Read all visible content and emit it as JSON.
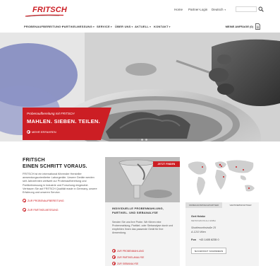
{
  "brand": {
    "name": "FRITSCH",
    "accent": "#cc1e24"
  },
  "top_links": {
    "home": "Home",
    "partner_login": "Partner-Login",
    "language": "Deutsch",
    "search_icon": "search-icon"
  },
  "nav": {
    "items": [
      "PROBENAUFBEREITUNG",
      "PARTIKELMESSUNG",
      "SERVICE",
      "ÜBER UNS",
      "AKTUELL",
      "KONTAKT"
    ],
    "cta": "MEINE ANFRAGE (0)",
    "cta_icon": "document-icon"
  },
  "hero": {
    "kicker": "Probenaufbereitung mit FRITSCH",
    "title": "MAHLEN. SIEBEN. TEILEN.",
    "link": "MEHR ERFAHREN",
    "slide_count": 3,
    "active_slide": 1
  },
  "intro": {
    "title_line1": "FRITSCH",
    "title_line2": "EINEN SCHRITT VORAUS.",
    "body": "FRITSCH ist ein international führender Hersteller anwendungsorientierter Laborgeräte. Unsere Geräte werden seit Jahrzehnten weltweit zur Proben­aufbereitung und Partikelmessung in Industrie und Forschung eingesetzt. Vertrauen Sie auf FRITSCH Qualität made in Germany, unsere Erfahrung und unseren Service.",
    "link1": "ZUR PROBENAUFBEREITUNG",
    "link2": "ZUR PARTIKELMESSUNG"
  },
  "card": {
    "badge": "JETZT FINDEN",
    "title": "INDIVIDUELLE PROBENMAHLUNG, PARTIKEL- UND SIEBANALYSE",
    "body": "Senden Sie uns Ihre Probe. Wir führen eine Probenmahlung, Partikel- oder Siebanalyse durch und empfehlen Ihnen das passende Gerät für Ihre Anwendung.",
    "links": [
      "ZUR PROBENMAHLUNG",
      "ZUR PARTIKELANALYSE",
      "ZUR SIEBANALYSE"
    ]
  },
  "contact": {
    "tabs": [
      "FIRMENANSPRECHPARTNER",
      "VERTRIEBSPARTNER"
    ],
    "active_tab": 0,
    "name": "Gert Heinke",
    "company": "METROHM INULA GMBH",
    "street": "Shuttleworthstraße 25",
    "city": "A-1210 Wien",
    "fon_label": "Fon",
    "fon": "+43 1405 6235 0",
    "button": "NACHRICHT SCHREIBEN"
  }
}
